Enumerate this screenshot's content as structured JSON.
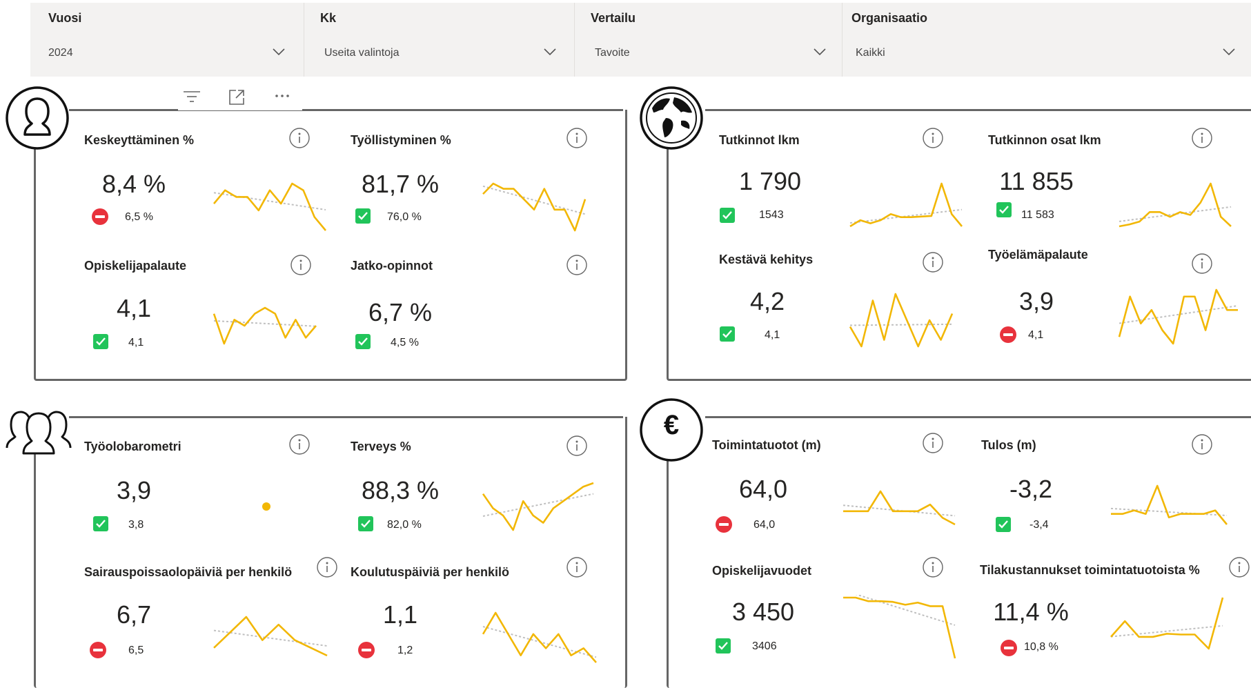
{
  "slicers": [
    {
      "title": "Vuosi",
      "value": "2024"
    },
    {
      "title": "Kk",
      "value": "Useita valintoja"
    },
    {
      "title": "Vertailu",
      "value": "Tavoite"
    },
    {
      "title": "Organisaatio",
      "value": "Kaikki"
    }
  ],
  "icons": {
    "panel1": "person-icon",
    "panel2": "globe-icon",
    "panel3": "group-icon",
    "panel4": "euro-icon",
    "visual_tools": [
      "filter-icon",
      "focus-mode-icon",
      "more-options-icon"
    ],
    "euro_symbol": "€"
  },
  "colors": {
    "sparkline": "#f2b705",
    "trend": "#bfbfbf",
    "status_ok": "#21c45a",
    "status_bad": "#e8323c"
  },
  "kpis": [
    {
      "title": "Keskeyttäminen %",
      "value": "8,4 %",
      "target": "6,5 %",
      "status": "bad",
      "trend": [
        5,
        7,
        6,
        6,
        4,
        7,
        5,
        8,
        7,
        3,
        1
      ]
    },
    {
      "title": "Työllistyminen %",
      "value": "81,7 %",
      "target": "76,0 %",
      "status": "ok",
      "trend": [
        7,
        9,
        8,
        8,
        6,
        4,
        8,
        4,
        4,
        0,
        6
      ]
    },
    {
      "title": "Opiskelijapalaute",
      "value": "4,1",
      "target": "4,1",
      "status": "ok",
      "trend": [
        6,
        1,
        5,
        4,
        6,
        7,
        6,
        2,
        5,
        2,
        4
      ]
    },
    {
      "title": "Jatko-opinnot",
      "value": "6,7 %",
      "target": "4,5 %",
      "status": "ok",
      "trend": []
    },
    {
      "title": "Tutkinnot lkm",
      "value": "1 790",
      "target": "1543",
      "status": "ok",
      "trend": [
        1,
        2,
        1.5,
        2,
        3,
        2.5,
        2.5,
        2.6,
        2.7,
        8,
        3,
        1
      ]
    },
    {
      "title": "Tutkinnon osat lkm",
      "value": "11 855",
      "target": "11 583",
      "status": "ok",
      "trend": [
        2,
        2.2,
        2.5,
        3.5,
        3.5,
        3,
        3.5,
        3.2,
        4.5,
        6.5,
        3,
        2
      ]
    },
    {
      "title": "Kestävä kehitys",
      "value": "4,2",
      "target": "4,1",
      "status": "ok",
      "trend": [
        4,
        1,
        8,
        2,
        9,
        5,
        1,
        5,
        2,
        6
      ]
    },
    {
      "title": "Työelämäpalaute",
      "value": "3,9",
      "target": "4,1",
      "status": "bad",
      "trend": [
        2,
        8,
        4,
        6,
        3,
        1,
        8,
        8,
        3,
        9,
        6,
        6
      ]
    },
    {
      "title": "Työolobarometri",
      "value": "3,9",
      "target": "3,8",
      "status": "ok",
      "trend": [
        5
      ]
    },
    {
      "title": "Terveys %",
      "value": "88,3 %",
      "target": "82,0 %",
      "status": "ok",
      "trend": [
        6,
        4,
        3,
        1,
        5,
        3,
        2,
        4,
        5,
        6,
        7,
        7.5
      ]
    },
    {
      "title": "Sairauspoissaolopäiviä per henkilö",
      "value": "6,7",
      "target": "6,5",
      "status": "bad",
      "trend": [
        3,
        5,
        7,
        4,
        6,
        4,
        3,
        2
      ]
    },
    {
      "title": "Koulutuspäiviä per henkilö",
      "value": "1,1",
      "target": "1,2",
      "status": "bad",
      "trend": [
        4,
        7,
        4,
        1,
        4,
        2,
        4,
        1,
        2,
        0
      ]
    },
    {
      "title": "Toimintatuotot (m)",
      "value": "64,0",
      "target": "64,0",
      "status": "bad",
      "trend": [
        4,
        4,
        4,
        7,
        4,
        4,
        4,
        5,
        3,
        2
      ]
    },
    {
      "title": "Tulos (m)",
      "value": "-3,2",
      "target": "-3,4",
      "status": "ok",
      "trend": [
        4,
        4,
        4.5,
        4,
        8,
        3.5,
        4,
        4,
        4,
        4.5,
        2.5
      ]
    },
    {
      "title": "Opiskelijavuodet",
      "value": "3 450",
      "target": "3406",
      "status": "ok",
      "trend": [
        9,
        9,
        8.5,
        8.5,
        8.4,
        8,
        8.3,
        7.8,
        7.8,
        0.5
      ]
    },
    {
      "title": "Tilakustannukset toimintatuotoista %",
      "value": "11,4 %",
      "target": "10,8 %",
      "status": "bad",
      "trend": [
        2,
        4,
        2,
        2,
        2.4,
        2.3,
        2.3,
        0.5,
        7
      ]
    }
  ]
}
